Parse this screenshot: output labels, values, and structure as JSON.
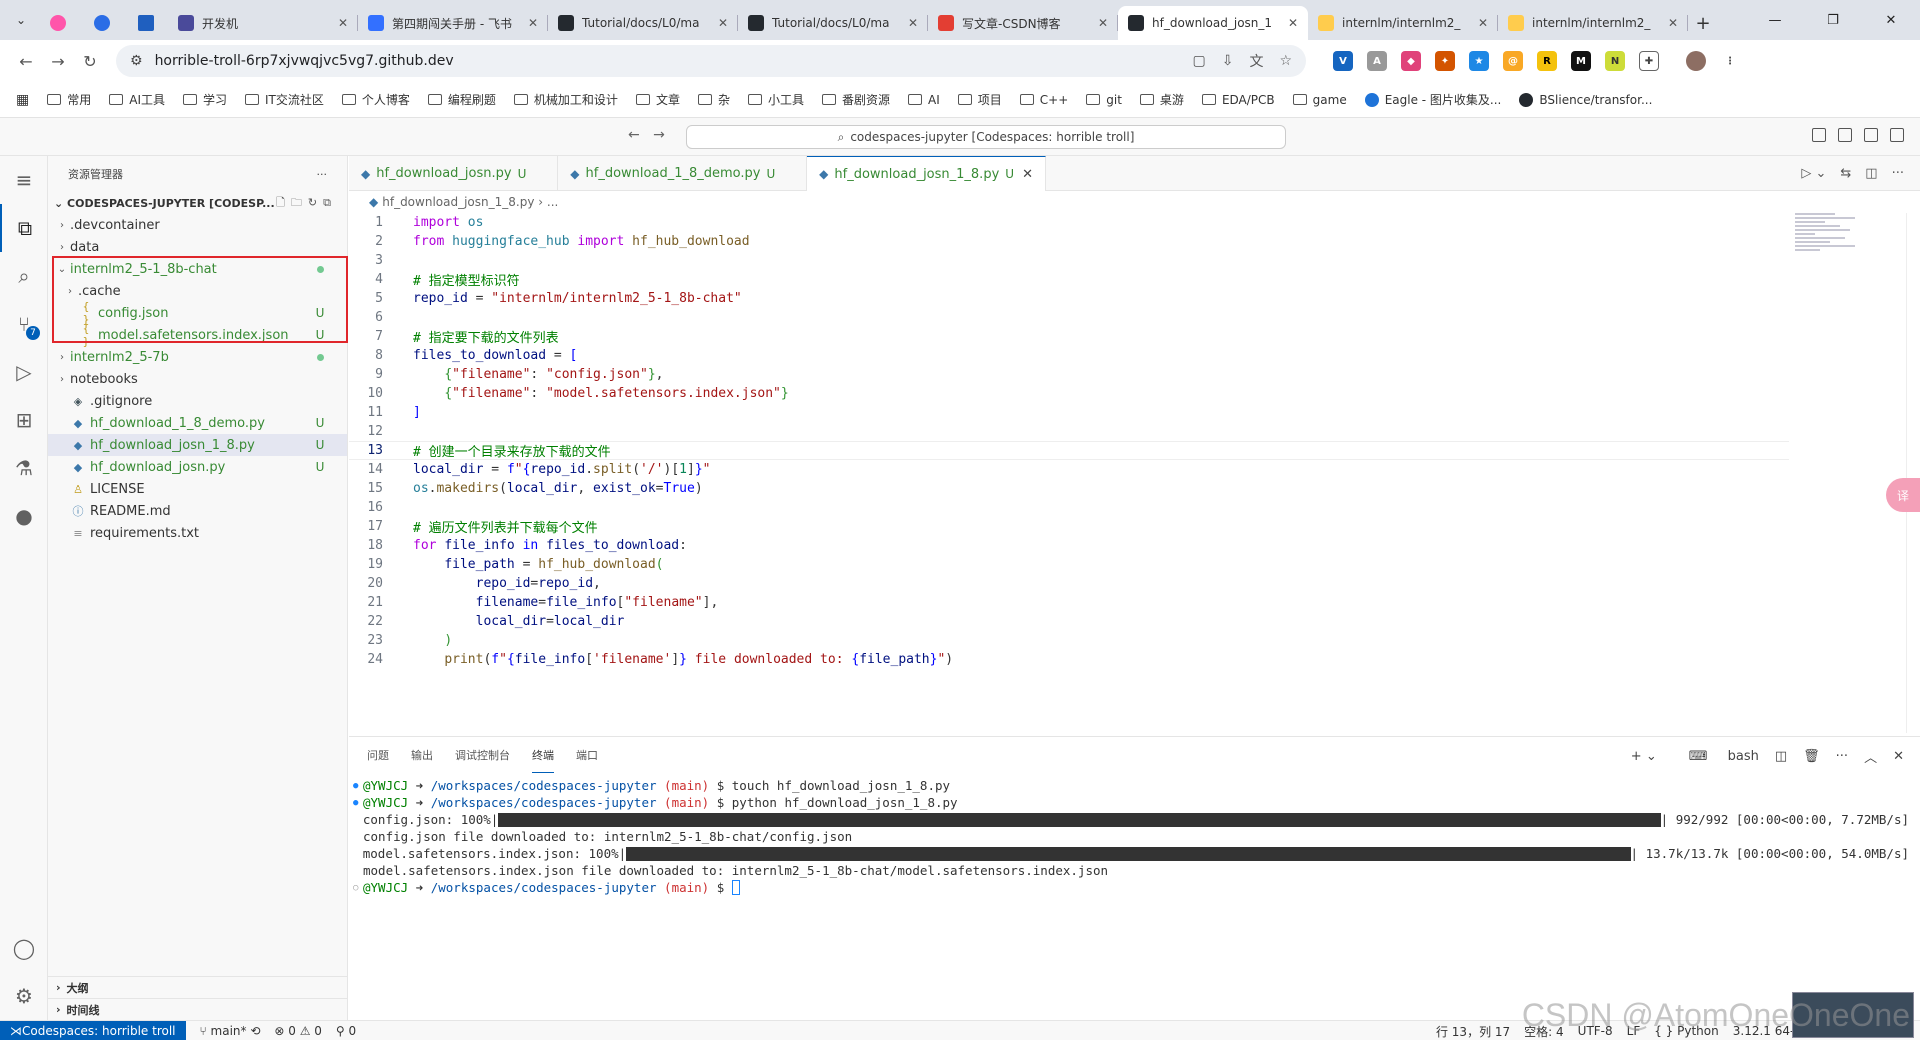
{
  "browser": {
    "tabs": [
      {
        "title": "开发机",
        "color": "#4a4a9a",
        "active": false
      },
      {
        "title": "第四期闯关手册 - 飞书",
        "color": "#3370ff",
        "active": false
      },
      {
        "title": "Tutorial/docs/L0/ma",
        "color": "#24292f",
        "active": false
      },
      {
        "title": "Tutorial/docs/L0/ma",
        "color": "#24292f",
        "active": false
      },
      {
        "title": "写文章-CSDN博客",
        "color": "#e33e33",
        "active": false
      },
      {
        "title": "hf_download_josn_1",
        "color": "#24292f",
        "active": true
      },
      {
        "title": "internlm/internlm2_",
        "color": "#ffcc4d",
        "active": false
      },
      {
        "title": "internlm/internlm2_",
        "color": "#ffcc4d",
        "active": false
      }
    ],
    "url": "horrible-troll-6rp7xjvwqjvc5vg7.github.dev",
    "bookmarks": [
      {
        "label": "常用",
        "type": "folder"
      },
      {
        "label": "AI工具",
        "type": "folder"
      },
      {
        "label": "学习",
        "type": "folder"
      },
      {
        "label": "IT交流社区",
        "type": "folder"
      },
      {
        "label": "个人博客",
        "type": "folder"
      },
      {
        "label": "编程刷题",
        "type": "folder"
      },
      {
        "label": "机械加工和设计",
        "type": "folder"
      },
      {
        "label": "文章",
        "type": "folder"
      },
      {
        "label": "杂",
        "type": "folder"
      },
      {
        "label": "小工具",
        "type": "folder"
      },
      {
        "label": "番剧资源",
        "type": "folder"
      },
      {
        "label": "AI",
        "type": "folder"
      },
      {
        "label": "项目",
        "type": "folder"
      },
      {
        "label": "C++",
        "type": "folder"
      },
      {
        "label": "git",
        "type": "folder"
      },
      {
        "label": "桌游",
        "type": "folder"
      },
      {
        "label": "EDA/PCB",
        "type": "folder"
      },
      {
        "label": "game",
        "type": "folder"
      },
      {
        "label": "Eagle - 图片收集及...",
        "type": "link"
      },
      {
        "label": "BSlience/transfor...",
        "type": "link"
      }
    ]
  },
  "vscode": {
    "command_center": "codespaces-jupyter [Codespaces: horrible troll]",
    "explorer_title": "资源管理器",
    "root": "CODESPACES-JUPYTER [CODESP...",
    "tree": [
      {
        "label": ".devcontainer",
        "kind": "folder",
        "depth": 0,
        "status": "",
        "green": false,
        "open": false
      },
      {
        "label": "data",
        "kind": "folder",
        "depth": 0,
        "status": "",
        "green": false,
        "open": false
      },
      {
        "label": "internlm2_5-1_8b-chat",
        "kind": "folder",
        "depth": 0,
        "status": "dot",
        "green": true,
        "open": true
      },
      {
        "label": ".cache",
        "kind": "folder",
        "depth": 1,
        "status": "",
        "green": false,
        "open": false
      },
      {
        "label": "config.json",
        "kind": "json",
        "depth": 1,
        "status": "U",
        "green": true,
        "open": false
      },
      {
        "label": "model.safetensors.index.json",
        "kind": "json",
        "depth": 1,
        "status": "U",
        "green": true,
        "open": false
      },
      {
        "label": "internlm2_5-7b",
        "kind": "folder",
        "depth": 0,
        "status": "dot",
        "green": true,
        "open": false
      },
      {
        "label": "notebooks",
        "kind": "folder",
        "depth": 0,
        "status": "",
        "green": false,
        "open": false
      },
      {
        "label": ".gitignore",
        "kind": "git",
        "depth": 0,
        "status": "",
        "green": false,
        "open": false
      },
      {
        "label": "hf_download_1_8_demo.py",
        "kind": "py",
        "depth": 0,
        "status": "U",
        "green": true,
        "open": false
      },
      {
        "label": "hf_download_josn_1_8.py",
        "kind": "py",
        "depth": 0,
        "status": "U",
        "green": true,
        "open": false,
        "selected": true
      },
      {
        "label": "hf_download_josn.py",
        "kind": "py",
        "depth": 0,
        "status": "U",
        "green": true,
        "open": false
      },
      {
        "label": "LICENSE",
        "kind": "license",
        "depth": 0,
        "status": "",
        "green": false,
        "open": false
      },
      {
        "label": "README.md",
        "kind": "info",
        "depth": 0,
        "status": "",
        "green": false,
        "open": false
      },
      {
        "label": "requirements.txt",
        "kind": "txt",
        "depth": 0,
        "status": "",
        "green": false,
        "open": false
      }
    ],
    "outline": "大纲",
    "timeline": "时间线",
    "editor_tabs": [
      {
        "label": "hf_download_josn.py",
        "status": "U",
        "active": false
      },
      {
        "label": "hf_download_1_8_demo.py",
        "status": "U",
        "active": false
      },
      {
        "label": "hf_download_josn_1_8.py",
        "status": "U",
        "active": true
      }
    ],
    "breadcrumb": "hf_download_josn_1_8.py",
    "breadcrumb_more": "...",
    "current_line": 13,
    "panel_tabs": [
      "问题",
      "输出",
      "调试控制台",
      "终端",
      "端口"
    ],
    "active_panel_tab": "终端",
    "shell": "bash",
    "terminal": {
      "user": "@YWJCJ",
      "path": "/workspaces/codespaces-jupyter",
      "branch": "(main)",
      "cmd1": "touch hf_download_josn_1_8.py",
      "cmd2": "python hf_download_josn_1_8.py",
      "line3_label": "config.json: 100%",
      "line3_stats": "992/992 [00:00<00:00, 7.72MB/s]",
      "line4": "config.json file downloaded to: internlm2_5-1_8b-chat/config.json",
      "line5_label": "model.safetensors.index.json: 100%",
      "line5_stats": "13.7k/13.7k [00:00<00:00, 54.0MB/s]",
      "line6": "model.safetensors.index.json file downloaded to: internlm2_5-1_8b-chat/model.safetensors.index.json",
      "progress1": 100,
      "progress2": 100
    },
    "status": {
      "remote": "Codespaces: horrible troll",
      "branch": "main*",
      "problems": "⊗ 0 ⚠ 0",
      "ports": "⚲ 0",
      "position": "行 13，列 17",
      "spaces": "空格: 4",
      "encoding": "UTF-8",
      "eol": "LF",
      "language": "Python",
      "interpreter": "3.12.1 64-bit"
    }
  },
  "watermark": "CSDN @AtomOneOneOne"
}
